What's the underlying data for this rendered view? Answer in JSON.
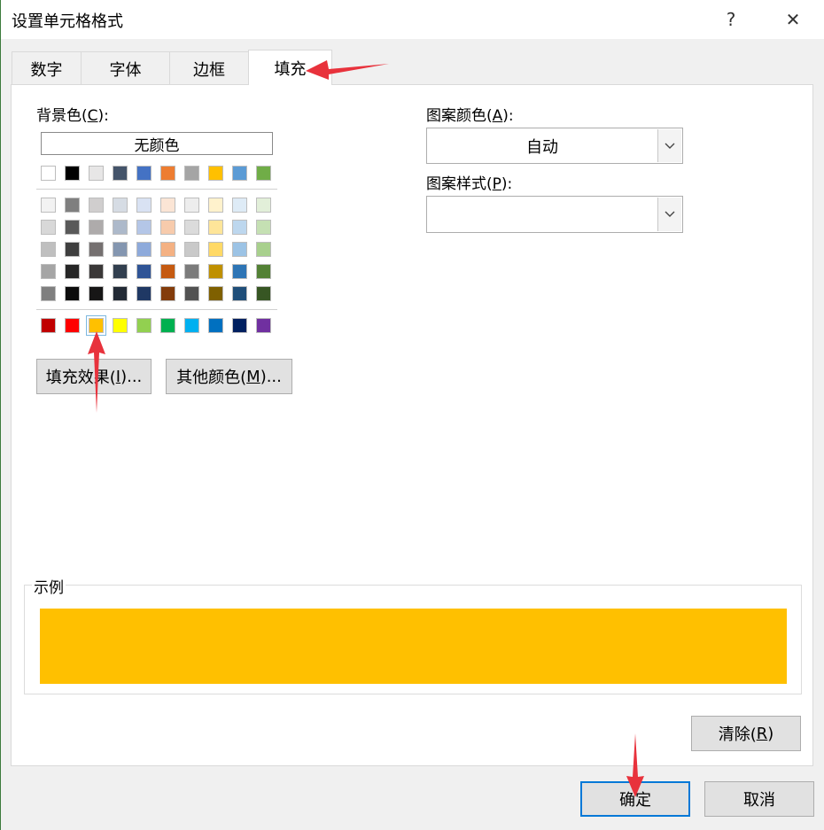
{
  "window": {
    "title": "设置单元格格式",
    "help": "?",
    "close": "✕"
  },
  "tabs": [
    {
      "label": "数字"
    },
    {
      "label": "字体"
    },
    {
      "label": "边框"
    },
    {
      "label": "填充",
      "active": true
    }
  ],
  "background": {
    "label_prefix": "背景色(",
    "label_key": "C",
    "label_suffix": "):",
    "no_color": "无颜色",
    "theme_top": [
      "#ffffff",
      "#000000",
      "#e7e6e6",
      "#44546a",
      "#4472c4",
      "#ed7d31",
      "#a5a5a5",
      "#ffc000",
      "#5b9bd5",
      "#70ad47"
    ],
    "theme_shades": [
      [
        "#f2f2f2",
        "#7f7f7f",
        "#d0cece",
        "#d6dce4",
        "#d9e2f3",
        "#fbe5d5",
        "#ededed",
        "#fff2cc",
        "#deebf6",
        "#e2efd9"
      ],
      [
        "#d8d8d8",
        "#595959",
        "#aeabab",
        "#adb9ca",
        "#b4c6e7",
        "#f7cbac",
        "#dbdbdb",
        "#fee599",
        "#bdd7ee",
        "#c5e0b3"
      ],
      [
        "#bfbfbf",
        "#3f3f3f",
        "#757070",
        "#8496b0",
        "#8eaadb",
        "#f4b183",
        "#c9c9c9",
        "#ffd966",
        "#9cc3e5",
        "#a8d08d"
      ],
      [
        "#a5a5a5",
        "#262626",
        "#3a3838",
        "#323f4f",
        "#2f5496",
        "#c55a11",
        "#7b7b7b",
        "#bf9000",
        "#2e75b5",
        "#538135"
      ],
      [
        "#7f7f7f",
        "#0c0c0c",
        "#171616",
        "#222a35",
        "#1f3864",
        "#833c0b",
        "#525252",
        "#7f6000",
        "#1f4e79",
        "#375623"
      ]
    ],
    "standard": [
      "#c00000",
      "#ff0000",
      "#ffc000",
      "#ffff00",
      "#92d050",
      "#00b050",
      "#00b0f0",
      "#0070c0",
      "#002060",
      "#7030a0"
    ],
    "selected_index": 2,
    "fill_effects_prefix": "填充效果(",
    "fill_effects_key": "I",
    "fill_effects_suffix": ")...",
    "more_colors_prefix": "其他颜色(",
    "more_colors_key": "M",
    "more_colors_suffix": ")..."
  },
  "pattern": {
    "color_label_prefix": "图案颜色(",
    "color_label_key": "A",
    "color_label_suffix": "):",
    "color_value": "自动",
    "style_label_prefix": "图案样式(",
    "style_label_key": "P",
    "style_label_suffix": "):",
    "style_value": ""
  },
  "sample": {
    "label": "示例",
    "color": "#ffc000"
  },
  "buttons": {
    "clear_prefix": "清除(",
    "clear_key": "R",
    "clear_suffix": ")",
    "ok": "确定",
    "cancel": "取消"
  },
  "annotation_color": "#e8323c"
}
